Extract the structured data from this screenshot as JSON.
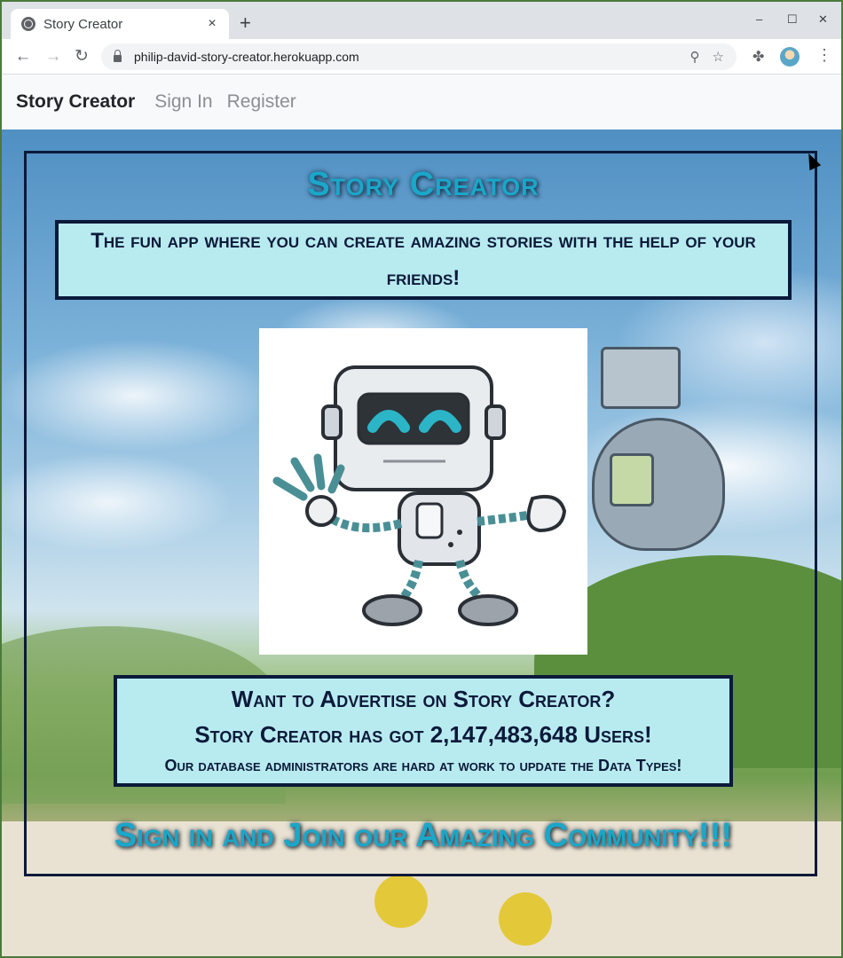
{
  "browser": {
    "tab_title": "Story Creator",
    "tab_close": "×",
    "new_tab": "+",
    "window_controls": {
      "minimize": "–",
      "maximize": "☐",
      "close": "✕"
    },
    "nav": {
      "back": "←",
      "forward": "→",
      "reload": "↻"
    },
    "url": "philip-david-story-creator.herokuapp.com",
    "zoom_icon": "⚲",
    "star_icon": "☆",
    "extensions_icon": "✤",
    "menu_icon": "⋮"
  },
  "appnav": {
    "brand": "Story Creator",
    "links": [
      "Sign In",
      "Register"
    ]
  },
  "hero": {
    "title": "Story Creator",
    "tagline": "The fun app where you can create amazing stories with the help of your friends!",
    "ad_line1": "Want to Advertise on Story Creator?",
    "ad_line2": "Story Creator has got 2,147,483,648 Users!",
    "ad_line3": "Our database administrators are hard at work to update the Data Types!",
    "cta": "Sign in and Join our Amazing Community!!!"
  },
  "colors": {
    "accent_title": "#1aa7c9",
    "box_fill": "#b8ebf0",
    "border_navy": "#0b1a3a",
    "robot_teal": "#2bb5c7"
  }
}
